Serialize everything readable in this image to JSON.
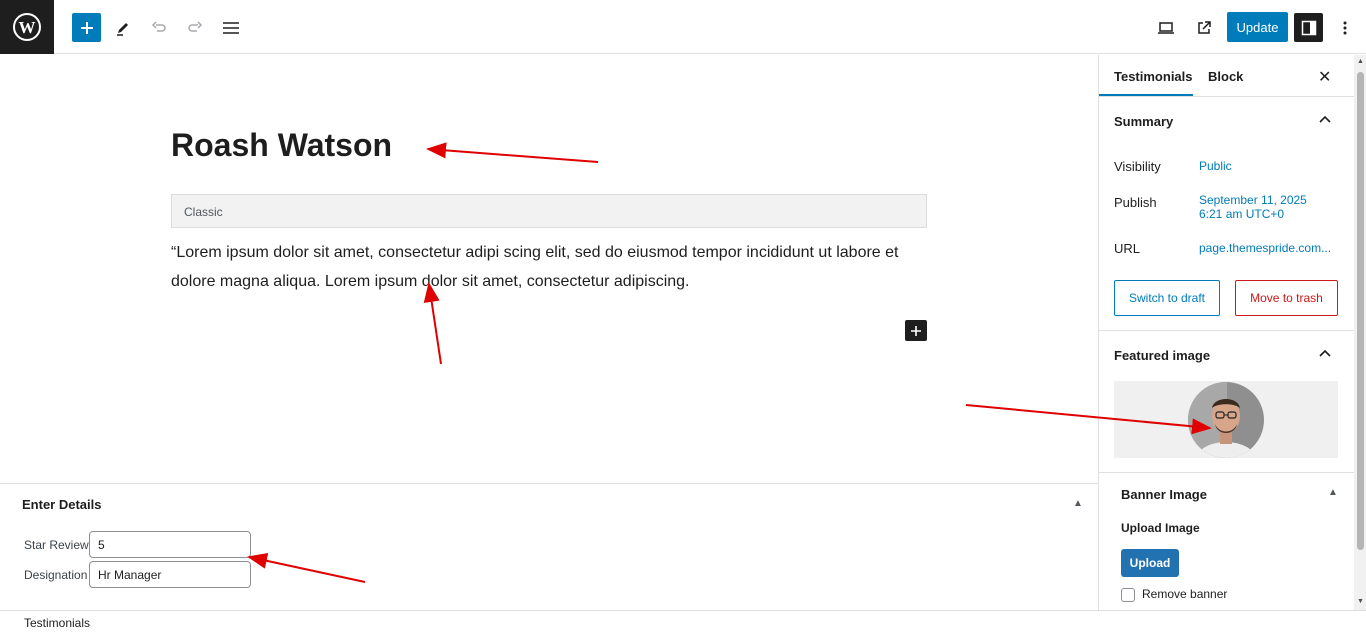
{
  "toolbar": {
    "logo_icon": "wordpress-logo-icon",
    "add_icon": "plus-icon",
    "tools_icon": "pencil-icon",
    "undo_icon": "undo-icon",
    "redo_icon": "redo-icon",
    "outline_icon": "list-view-icon",
    "preview_icon": "laptop-icon",
    "view_icon": "external-link-icon",
    "update_label": "Update",
    "settings_icon": "sidebar-toggle-icon",
    "options_icon": "vertical-ellipsis-icon"
  },
  "editor": {
    "title": "Roash Watson",
    "classic_label": "Classic",
    "content": "“Lorem ipsum dolor sit amet, consectetur adipi scing elit, sed do eiusmod tempor incididunt ut labore et dolore magna aliqua. Lorem ipsum dolor sit amet, consectetur adipiscing."
  },
  "metabox": {
    "title": "Enter Details",
    "fields": [
      {
        "label": "Star Review",
        "value": "5"
      },
      {
        "label": "Designation",
        "value": "Hr Manager"
      }
    ]
  },
  "footer": {
    "breadcrumb": "Testimonials"
  },
  "sidebar": {
    "tabs": [
      "Testimonials",
      "Block"
    ],
    "summary": {
      "title": "Summary",
      "visibility_label": "Visibility",
      "visibility_value": "Public",
      "publish_label": "Publish",
      "publish_date": "September 11, 2025",
      "publish_time": "6:21 am UTC+0",
      "url_label": "URL",
      "url_value": "page.themespride.com...",
      "switch_draft": "Switch to draft",
      "move_trash": "Move to trash"
    },
    "featured_image": {
      "title": "Featured image"
    },
    "banner": {
      "title": "Banner Image",
      "upload_heading": "Upload Image",
      "upload_button": "Upload",
      "remove_label": "Remove banner"
    }
  },
  "colors": {
    "accent": "#007cba",
    "danger": "#cc1818",
    "annotation": "#e00000"
  }
}
